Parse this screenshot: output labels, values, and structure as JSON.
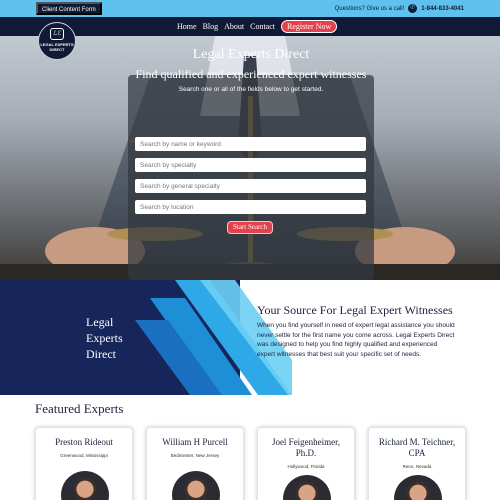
{
  "topbar": {
    "client_form_label": "Client Content Form",
    "questions_text": "Questions? Give us a call!",
    "phone": "1-844-833-4041",
    "phone_icon": "phone-icon"
  },
  "nav": {
    "items": [
      "Home",
      "Blog",
      "About",
      "Contact"
    ],
    "register_label": "Register Now"
  },
  "logo": {
    "mark": "ℒℰ",
    "text": "LEGAL EXPERTS DIRECT"
  },
  "hero": {
    "title": "Legal Experts Direct",
    "subtitle": "Find qualified and experienced expert witnesses",
    "hint": "Search one or all of the fields below to get started.",
    "fields": [
      {
        "placeholder": "Search by name or keyword"
      },
      {
        "placeholder": "Search by specialty"
      },
      {
        "placeholder": "Search by general specialty"
      },
      {
        "placeholder": "Search by location"
      }
    ],
    "search_label": "Start Search"
  },
  "about": {
    "brand_lines": [
      "Legal",
      "Experts",
      "Direct"
    ],
    "heading": "Your Source For Legal Expert Witnesses",
    "body": "When you find yourself in need of expert legal assistance you should never settle for the first name you come across. Legal Experts Direct was designed to help you find highly qualified and experienced expert witnesses that best suit your specific set of needs."
  },
  "featured": {
    "title": "Featured Experts",
    "experts": [
      {
        "name": "Preston Rideout",
        "location": "Greenwood, Mississippi"
      },
      {
        "name": "William H Purcell",
        "location": "Bedminster, New Jersey"
      },
      {
        "name": "Joel Feigenheimer, Ph.D.",
        "location": "Hollywood, Florida"
      },
      {
        "name": "Richard M. Teichner, CPA",
        "location": "Reno, Nevada"
      }
    ]
  },
  "colors": {
    "topbar": "#5fc1ee",
    "navy": "#101a36",
    "accent_red": "#e3414b",
    "graphic_blue": "#1e8fd6",
    "graphic_light": "#6ecff4"
  }
}
